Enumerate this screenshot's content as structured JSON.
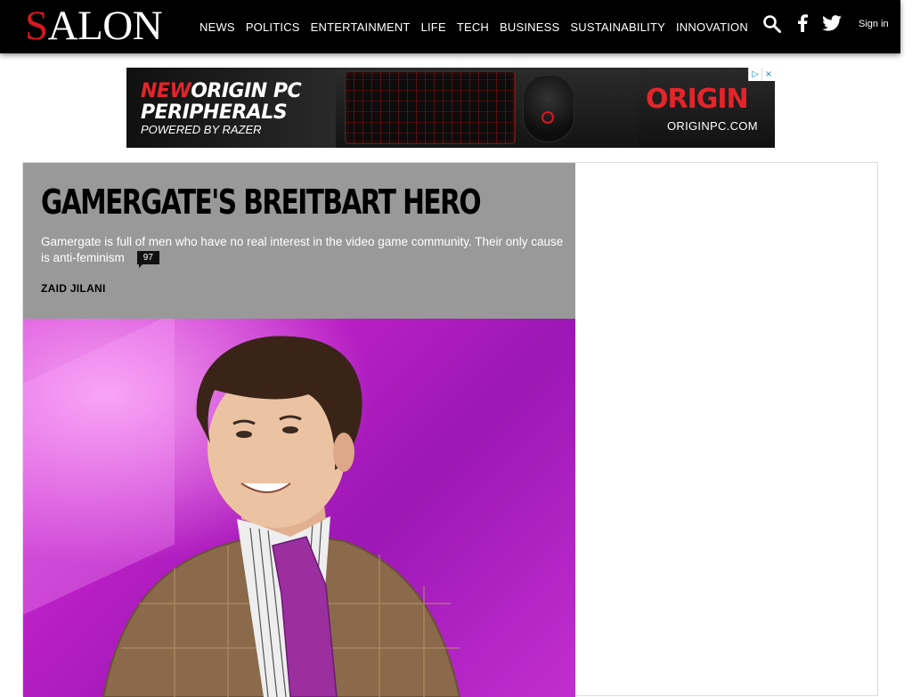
{
  "header": {
    "logo": "SALON",
    "nav": [
      "NEWS",
      "POLITICS",
      "ENTERTAINMENT",
      "LIFE",
      "TECH",
      "BUSINESS",
      "SUSTAINABILITY",
      "INNOVATION"
    ],
    "icons": [
      "search-icon",
      "facebook-icon",
      "twitter-icon"
    ],
    "signin": "Sign in"
  },
  "ad": {
    "headline_new": "NEW",
    "headline_rest": "ORIGIN PC",
    "headline_line2": "PERIPHERALS",
    "powered": "POWERED BY RAZER",
    "brand": "ORIGIN",
    "url": "ORIGINPC.COM",
    "choices": [
      "▷",
      "×"
    ]
  },
  "article": {
    "headline": "GAMERGATE'S BREITBART HERO",
    "dek": "Gamergate is full of men who have no real interest in the video game community. Their only cause is anti-feminism",
    "comments": "97",
    "byline": "ZAID JILANI"
  },
  "colors": {
    "header_bg": "#000000",
    "logo_accent": "#d71920",
    "hero_text_bg": "#999999",
    "photo_bg": "#b81fc4"
  }
}
